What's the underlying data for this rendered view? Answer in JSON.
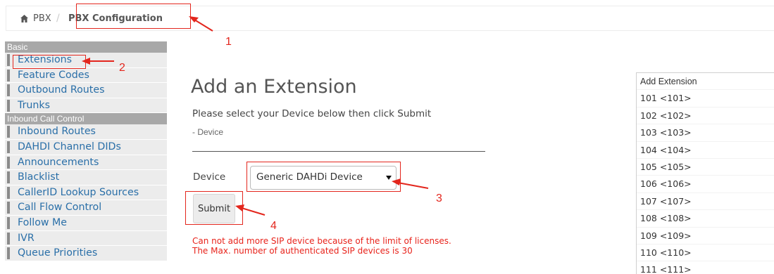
{
  "breadcrumb": {
    "home_icon": "home-icon",
    "root": "PBX",
    "separator": "/",
    "current": "PBX Configuration"
  },
  "sidebar": {
    "sections": [
      {
        "title": "Basic",
        "items": [
          "Extensions",
          "Feature Codes",
          "Outbound Routes",
          "Trunks"
        ]
      },
      {
        "title": "Inbound Call Control",
        "items": [
          "Inbound Routes",
          "DAHDI Channel DIDs",
          "Announcements",
          "Blacklist",
          "CallerID Lookup Sources",
          "Call Flow Control",
          "Follow Me",
          "IVR",
          "Queue Priorities"
        ]
      }
    ]
  },
  "main": {
    "title": "Add an Extension",
    "subtitle": "Please select your Device below then click Submit",
    "section_label": "- Device",
    "device_label": "Device",
    "device_value": "Generic DAHDi Device",
    "submit_label": "Submit",
    "error_lines": [
      "Can not add more SIP device because of the limit of licenses.",
      "The Max. number of authenticated SIP devices is 30"
    ]
  },
  "extensions_panel": {
    "header": "Add Extension",
    "items": [
      "101 <101>",
      "102 <102>",
      "103 <103>",
      "104 <104>",
      "105 <105>",
      "106 <106>",
      "107 <107>",
      "108 <108>",
      "109 <109>",
      "110 <110>",
      "111 <111>"
    ]
  },
  "annotations": {
    "numbers": [
      "1",
      "2",
      "3",
      "4"
    ],
    "color": "#e3261d"
  },
  "colors": {
    "link": "#2a6fa8",
    "sidebar_header": "#a8a8a8",
    "error": "#e8231b"
  }
}
